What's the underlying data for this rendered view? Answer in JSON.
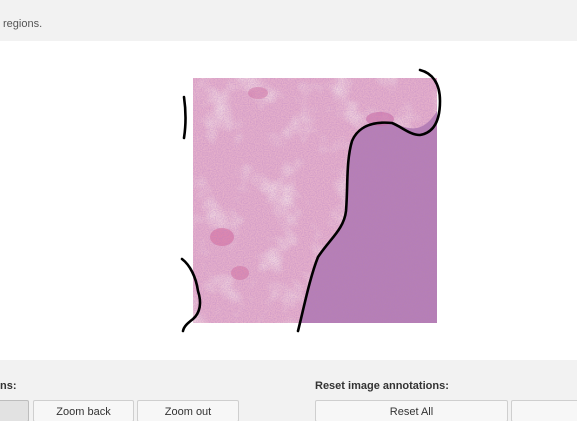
{
  "instructions": {
    "text": "regions."
  },
  "viewer": {
    "image_alt": "H&E stained tissue slide",
    "annotation_color": "#000000",
    "tissue_base_color": "#e6a9c4",
    "tissue_dense_color": "#9c6aa8"
  },
  "zoom_section": {
    "label": "ns:",
    "buttons": [
      {
        "label": ""
      },
      {
        "label": "Zoom back"
      },
      {
        "label": "Zoom out"
      }
    ]
  },
  "reset_section": {
    "label": "Reset image annotations:",
    "buttons": [
      {
        "label": "Reset All"
      },
      {
        "label": ""
      }
    ]
  }
}
